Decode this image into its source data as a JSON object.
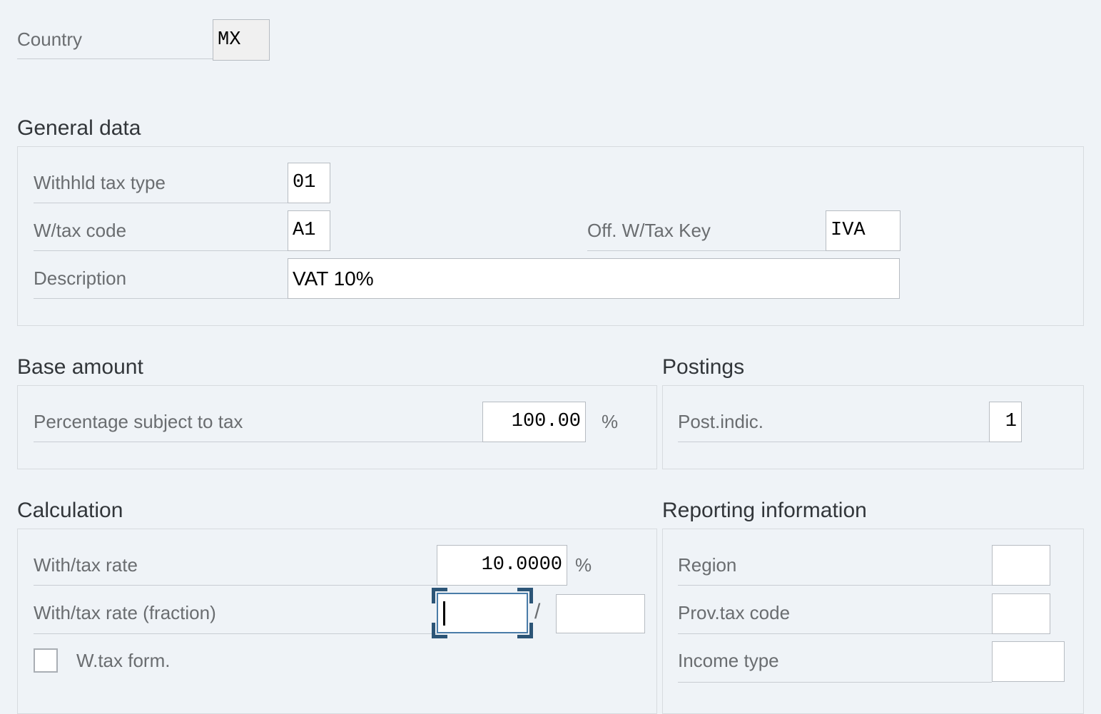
{
  "header": {
    "country_label": "Country",
    "country_value": "MX"
  },
  "sections": {
    "general_data": {
      "title": "General data",
      "fields": {
        "withhld_tax_type_label": "Withhld tax type",
        "withhld_tax_type_value": "01",
        "wtax_code_label": "W/tax code",
        "wtax_code_value": "A1",
        "off_wtax_key_label": "Off. W/Tax Key",
        "off_wtax_key_value": "IVA",
        "description_label": "Description",
        "description_value": "VAT 10%"
      }
    },
    "base_amount": {
      "title": "Base amount",
      "fields": {
        "percentage_label": "Percentage subject to tax",
        "percentage_value": "100.00",
        "percentage_unit": "%"
      }
    },
    "postings": {
      "title": "Postings",
      "fields": {
        "post_indic_label": "Post.indic.",
        "post_indic_value": "1"
      }
    },
    "calculation": {
      "title": "Calculation",
      "fields": {
        "with_tax_rate_label": "With/tax rate",
        "with_tax_rate_value": "10.0000",
        "with_tax_rate_unit": "%",
        "with_tax_rate_fraction_label": "With/tax rate (fraction)",
        "with_tax_rate_fraction_numerator": "",
        "with_tax_rate_fraction_separator": "/",
        "with_tax_rate_fraction_denominator": "",
        "wtax_form_label": "W.tax form.",
        "wtax_form_checked": false
      }
    },
    "reporting_information": {
      "title": "Reporting information",
      "fields": {
        "region_label": "Region",
        "region_value": "",
        "prov_tax_code_label": "Prov.tax code",
        "prov_tax_code_value": "",
        "income_type_label": "Income type",
        "income_type_value": ""
      }
    }
  },
  "colors": {
    "page_background": "#eff3f7",
    "panel_border": "#d7dbdf",
    "label_text": "#6a6d70",
    "heading_text": "#32363a",
    "input_border": "#b7bcc2",
    "focus_bracket": "#2c5577",
    "focus_border": "#4a7ca8",
    "rule": "#c8cdd3",
    "readonly_fill": "#f0f0f0"
  }
}
